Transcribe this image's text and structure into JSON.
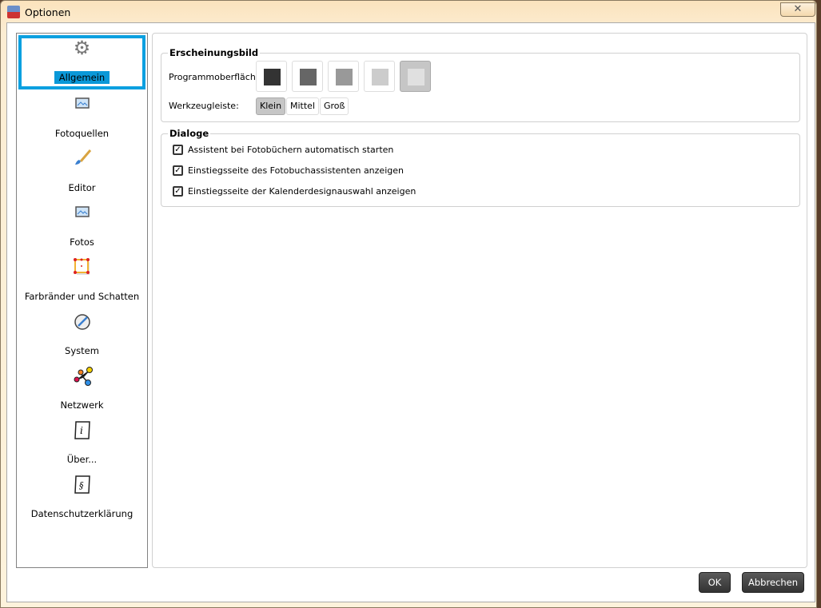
{
  "window": {
    "title": "Optionen",
    "close_icon": "close-icon"
  },
  "sidebar": {
    "items": [
      {
        "label": "Allgemein",
        "icon": "gear-icon",
        "selected": true
      },
      {
        "label": "Fotoquellen",
        "icon": "image-icon"
      },
      {
        "label": "Editor",
        "icon": "brush-icon"
      },
      {
        "label": "Fotos",
        "icon": "image-icon"
      },
      {
        "label": "Farbränder und Schatten",
        "icon": "frame-shadow-icon"
      },
      {
        "label": "System",
        "icon": "disc-icon"
      },
      {
        "label": "Netzwerk",
        "icon": "network-icon"
      },
      {
        "label": "Über...",
        "icon": "info-icon"
      },
      {
        "label": "Datenschutzerklärung",
        "icon": "paragraph-icon"
      }
    ]
  },
  "appearance": {
    "title": "Erscheinungsbild",
    "ui_label": "Programmoberfläche:",
    "swatches": [
      "#333333",
      "#666666",
      "#999999",
      "#cccccc",
      "#e0e0e0"
    ],
    "selected_swatch": 4,
    "toolbar_label": "Werkzeugleiste:",
    "toolbar_sizes": [
      "Klein",
      "Mittel",
      "Groß"
    ],
    "selected_size": 0
  },
  "dialogs": {
    "title": "Dialoge",
    "options": [
      {
        "label": "Assistent bei Fotobüchern automatisch starten",
        "checked": true
      },
      {
        "label": "Einstiegsseite des Fotobuchassistenten anzeigen",
        "checked": true
      },
      {
        "label": "Einstiegsseite der Kalenderdesignauswahl anzeigen",
        "checked": true
      }
    ]
  },
  "footer": {
    "ok": "OK",
    "cancel": "Abbrechen"
  }
}
